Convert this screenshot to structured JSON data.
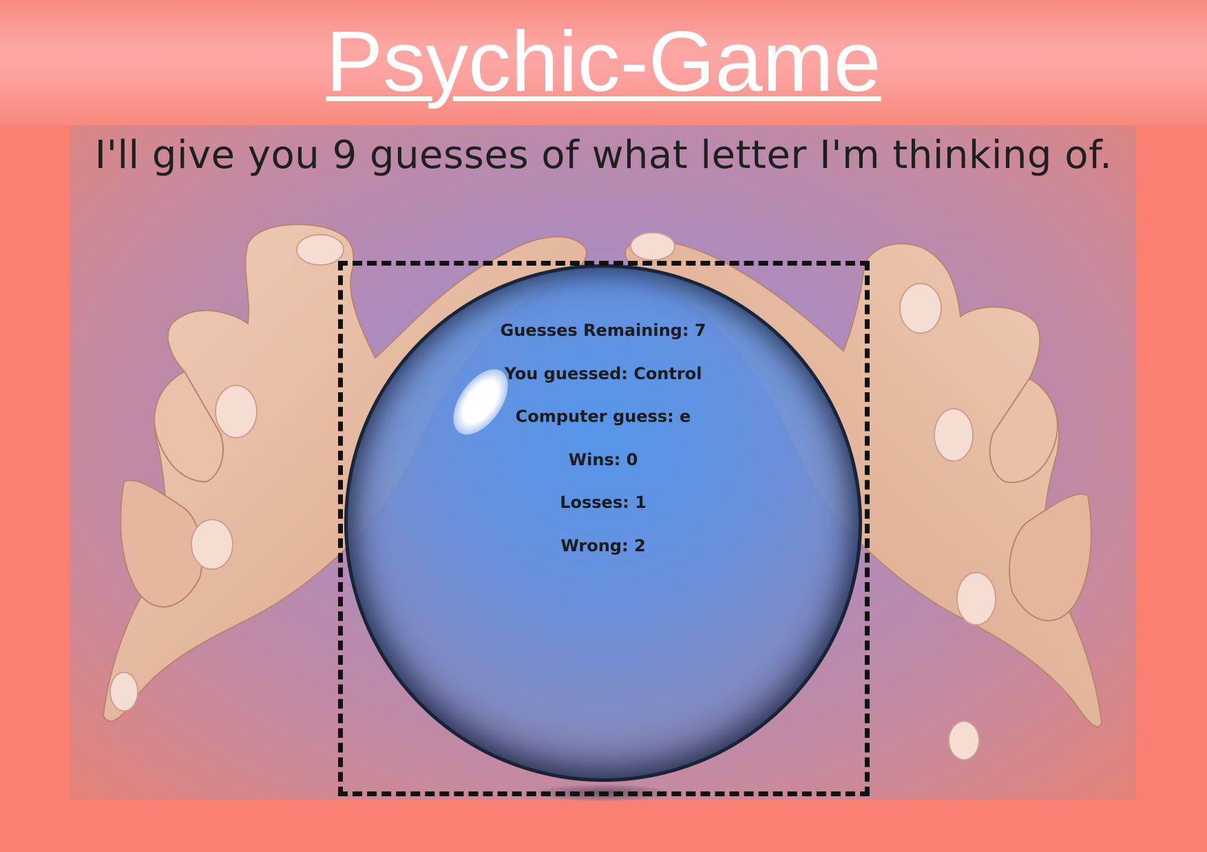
{
  "header": {
    "title": "Psychic-Game"
  },
  "intro": {
    "text": "I'll give you 9 guesses of what letter I'm thinking of."
  },
  "game": {
    "guesses_remaining": "Guesses Remaining: 7",
    "you_guessed": "You guessed: Control",
    "computer_guess": "Computer guess: e",
    "wins": "Wins: 0",
    "losses": "Losses: 1",
    "wrong": "Wrong: 2"
  },
  "colors": {
    "page_background": "#fa8072",
    "title_text": "#ffffff",
    "subtitle_text": "#1f1f1f",
    "crystal_ball": "#5b9be6",
    "box_border": "#111111",
    "skin": "#e8b9a0"
  }
}
